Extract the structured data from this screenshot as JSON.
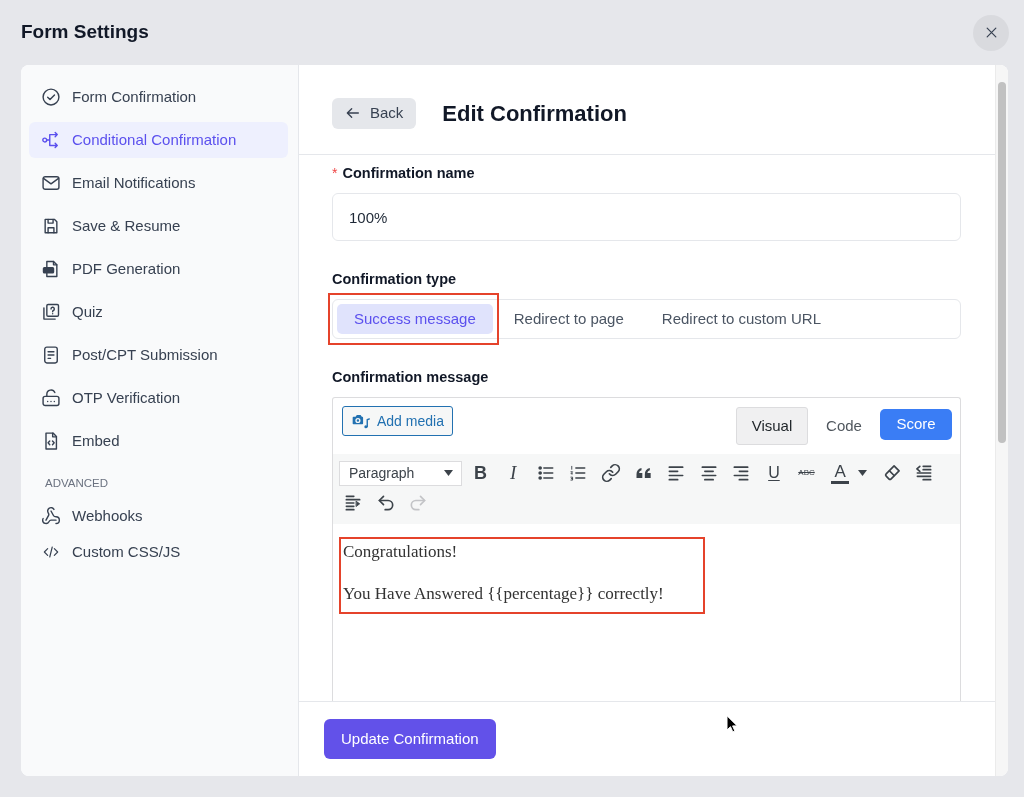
{
  "window": {
    "title": "Form Settings"
  },
  "sidebar": {
    "items": [
      {
        "label": "Form Confirmation",
        "selected": false
      },
      {
        "label": "Conditional Confirmation",
        "selected": true
      },
      {
        "label": "Email Notifications",
        "selected": false
      },
      {
        "label": "Save & Resume",
        "selected": false
      },
      {
        "label": "PDF Generation",
        "selected": false
      },
      {
        "label": "Quiz",
        "selected": false
      },
      {
        "label": "Post/CPT Submission",
        "selected": false
      },
      {
        "label": "OTP Verification",
        "selected": false
      },
      {
        "label": "Embed",
        "selected": false
      }
    ],
    "advanced": {
      "heading": "ADVANCED",
      "items": [
        {
          "label": "Webhooks",
          "selected": false
        },
        {
          "label": "Custom CSS/JS",
          "selected": false
        }
      ]
    }
  },
  "header": {
    "back_button": "Back",
    "title": "Edit Confirmation"
  },
  "form": {
    "name_field": {
      "required_mark": "*",
      "label": "Confirmation name",
      "value": "100%"
    },
    "type_field": {
      "label": "Confirmation type",
      "tabs": [
        {
          "label": "Success message",
          "selected": true,
          "highlighted": true
        },
        {
          "label": "Redirect to page",
          "selected": false,
          "highlighted": false
        },
        {
          "label": "Redirect to custom URL",
          "selected": false,
          "highlighted": false
        }
      ]
    },
    "message_field": {
      "label": "Confirmation message",
      "editor": {
        "add_media_button": "Add media",
        "modes": [
          {
            "label": "Visual",
            "selected": true
          },
          {
            "label": "Code",
            "selected": false
          }
        ],
        "score_button": "Score",
        "toolbar": [
          {
            "kind": "format",
            "value": "Paragraph",
            "disabled": false
          },
          {
            "kind": "bold",
            "glyph": "B",
            "disabled": false
          },
          {
            "kind": "italic",
            "glyph": "I",
            "disabled": false
          },
          {
            "kind": "bullet_list",
            "disabled": false
          },
          {
            "kind": "numbered_list",
            "disabled": false
          },
          {
            "kind": "link",
            "disabled": false
          },
          {
            "kind": "quote",
            "disabled": false
          },
          {
            "kind": "align_left",
            "disabled": false
          },
          {
            "kind": "align_center",
            "disabled": false
          },
          {
            "kind": "align_right",
            "disabled": false
          },
          {
            "kind": "underline",
            "glyph": "U",
            "disabled": false
          },
          {
            "kind": "strikethrough",
            "glyph": "ABC",
            "disabled": false
          },
          {
            "kind": "text_color",
            "glyph": "A",
            "disabled": false
          },
          {
            "kind": "clear_format",
            "disabled": false
          },
          {
            "kind": "outdent",
            "disabled": false
          },
          {
            "kind": "indent",
            "disabled": false
          },
          {
            "kind": "undo",
            "disabled": false
          },
          {
            "kind": "redo",
            "disabled": true
          }
        ],
        "content": {
          "highlighted": true,
          "paragraphs": [
            "Congratulations!",
            "You Have Answered {{percentage}} correctly!"
          ]
        }
      }
    }
  },
  "footer": {
    "submit_button": "Update Confirmation"
  }
}
